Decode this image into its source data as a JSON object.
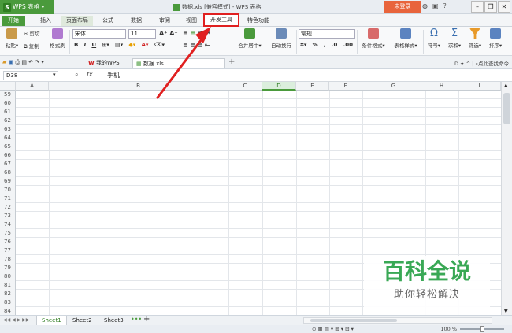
{
  "titlebar": {
    "app_name": "WPS 表格",
    "window_title": "数据.xls [兼容模式] - WPS 表格",
    "login_label": "未登录",
    "controls": [
      "minimize-icon",
      "restore-icon",
      "close-icon"
    ]
  },
  "menu_tabs": [
    {
      "label": "开始",
      "active": true
    },
    {
      "label": "插入"
    },
    {
      "label": "页面布局"
    },
    {
      "label": "公式"
    },
    {
      "label": "数据"
    },
    {
      "label": "审阅"
    },
    {
      "label": "视图"
    },
    {
      "label": "开发工具",
      "highlighted": true
    },
    {
      "label": "特色功能"
    }
  ],
  "ribbon": {
    "paste": "粘贴",
    "cut": "剪切",
    "copy": "复制",
    "format_painter": "格式刷",
    "font_name": "宋体",
    "font_size": "11",
    "merge_center": "合并居中",
    "wrap_text": "自动换行",
    "number_format": "常规",
    "conditional_format": "条件格式",
    "table_style": "表格样式",
    "symbol": "符号",
    "sum": "求和",
    "filter": "筛选",
    "sort": "排序"
  },
  "doc_tabs": [
    {
      "label": "我的WPS"
    },
    {
      "label": "数据.xls",
      "active": true
    }
  ],
  "search_cmd": "点此查找命令",
  "formula": {
    "cell_ref": "D38",
    "fx": "fx",
    "value": "手机"
  },
  "columns": [
    "A",
    "B",
    "C",
    "D",
    "E",
    "F",
    "G",
    "H",
    "I"
  ],
  "selected_column": "D",
  "rows": [
    "59",
    "60",
    "61",
    "62",
    "63",
    "64",
    "65",
    "66",
    "67",
    "68",
    "69",
    "70",
    "71",
    "72",
    "73",
    "74",
    "75",
    "76",
    "77",
    "78",
    "79",
    "80",
    "81",
    "82",
    "83",
    "84"
  ],
  "sheets": [
    {
      "label": "Sheet1",
      "active": true
    },
    {
      "label": "Sheet2"
    },
    {
      "label": "Sheet3"
    }
  ],
  "zoom_level": "100 %",
  "watermark": {
    "title": "百科全说",
    "subtitle": "助你轻松解决"
  }
}
